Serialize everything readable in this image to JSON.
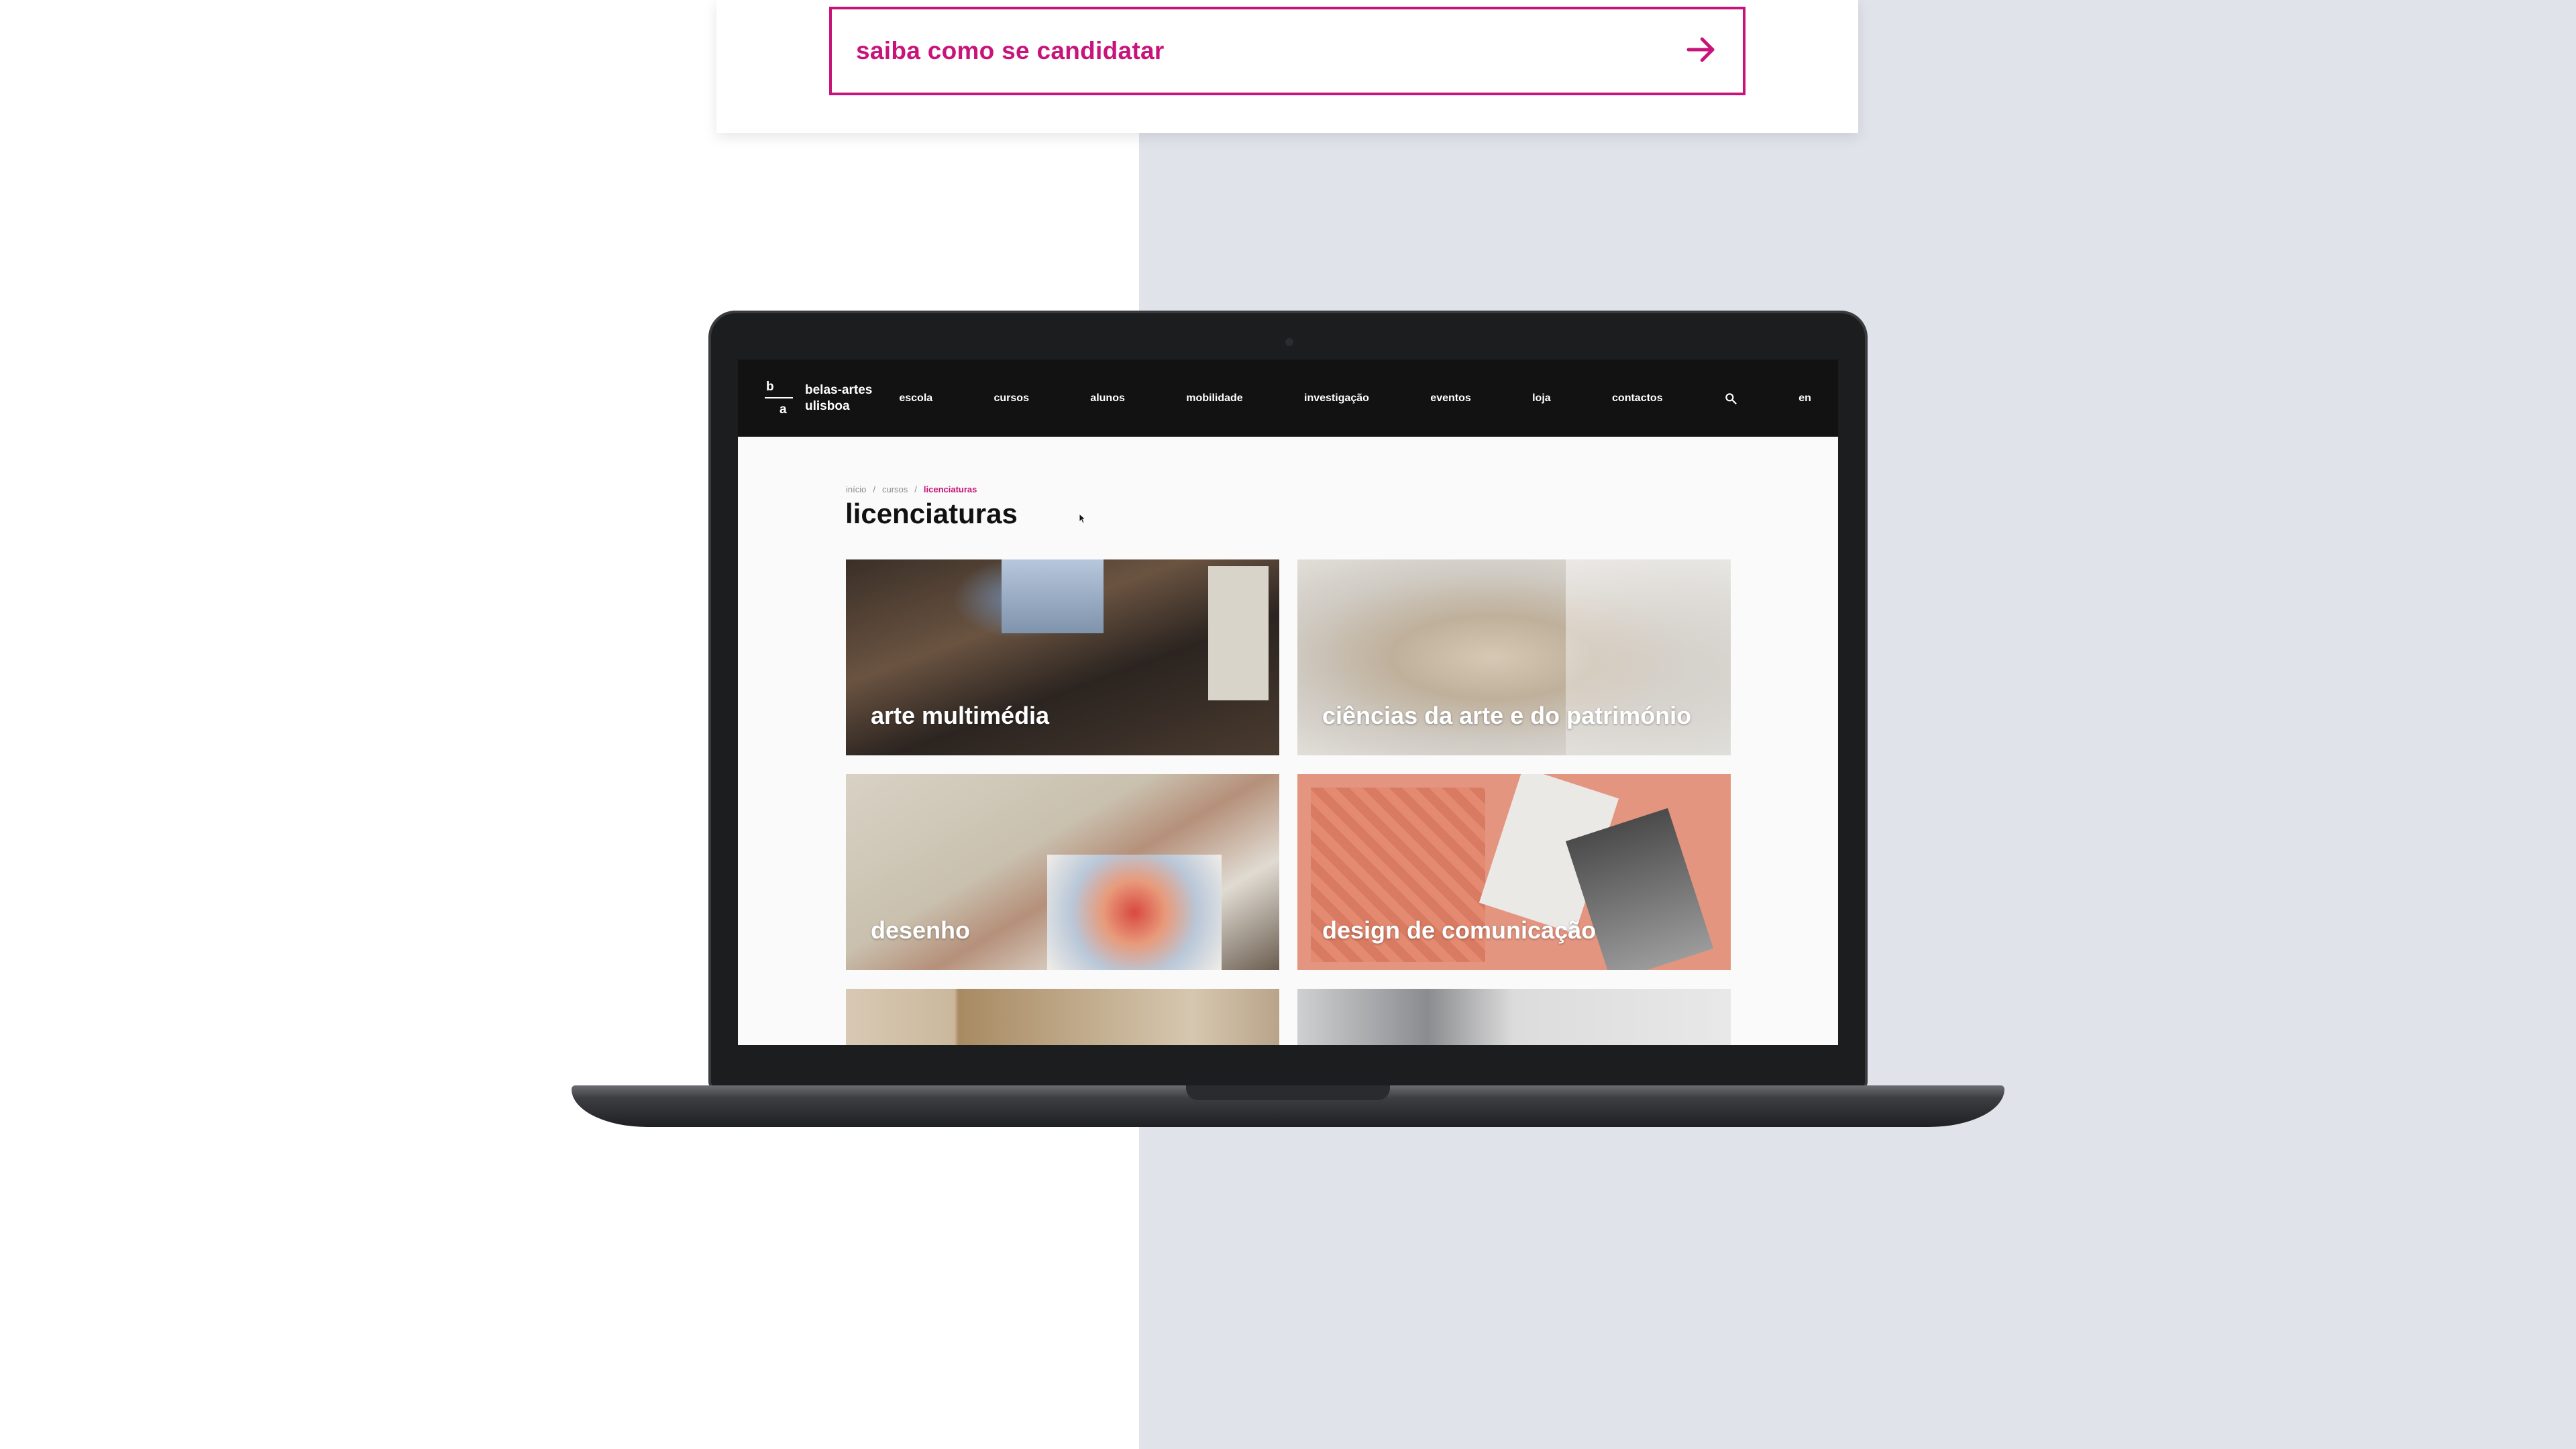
{
  "apply": {
    "label": "saiba como se candidatar"
  },
  "site": {
    "logo": {
      "mark_top": "b",
      "mark_bottom": "a",
      "line1": "belas-artes",
      "line2": "ulisboa"
    },
    "nav": [
      "escola",
      "cursos",
      "alunos",
      "mobilidade",
      "investigação",
      "eventos",
      "loja",
      "contactos"
    ],
    "lang": "en"
  },
  "breadcrumb": {
    "home": "início",
    "sep": "/",
    "level1": "cursos",
    "current": "licenciaturas"
  },
  "page": {
    "title": "licenciaturas"
  },
  "cards": [
    {
      "label": "arte multimédia"
    },
    {
      "label": "ciências da arte e do património"
    },
    {
      "label": "desenho"
    },
    {
      "label": "design de comunicação"
    },
    {
      "label": ""
    },
    {
      "label": ""
    }
  ],
  "colors": {
    "accent": "#c8137a",
    "header_bg": "#121212",
    "right_panel": "#e1e3eb"
  },
  "icons": {
    "apply": "arrow-right-icon",
    "search": "search-icon",
    "pointer": "mouse-cursor-icon"
  }
}
